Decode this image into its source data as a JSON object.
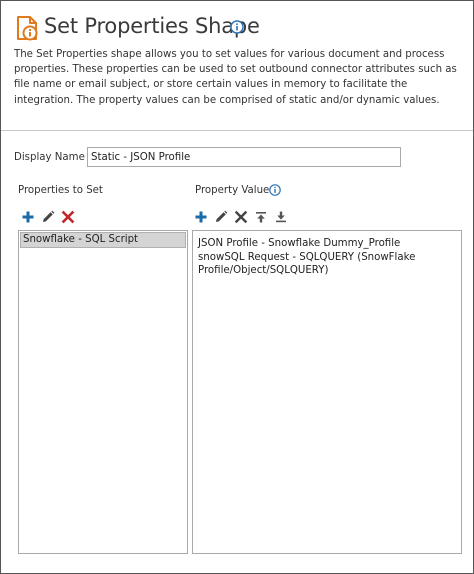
{
  "dialog": {
    "title": "Set Properties Shape",
    "description": "The Set Properties shape allows you to set values for various document and process properties. These properties can be used to set outbound connector attributes such as file name or email subject, or store certain values in memory to facilitate the integration. The property values can be comprised of static and/or dynamic values."
  },
  "display_name": {
    "label": "Display Name",
    "value": "Static - JSON Profile"
  },
  "properties_to_set": {
    "label": "Properties to Set",
    "toolbar": [
      "add-icon",
      "edit-icon",
      "delete-icon"
    ],
    "items": [
      "Snowflake - SQL Script"
    ]
  },
  "property_value": {
    "label": "Property Value",
    "toolbar": [
      "add-icon",
      "edit-icon",
      "delete-icon",
      "move-up-icon",
      "move-down-icon"
    ],
    "items": [
      "JSON Profile - Snowflake Dummy_Profile snowSQL Request - SQLQUERY (SnowFlake Profile/Object/SQLQUERY)"
    ]
  },
  "colors": {
    "icon_accent": "#e07a1f",
    "add": "#1a6aa8",
    "edit": "#444444",
    "delete_red": "#c0282d",
    "delete_dark": "#444444",
    "info": "#2a73b8",
    "selected_row": "#d4d4d4"
  }
}
